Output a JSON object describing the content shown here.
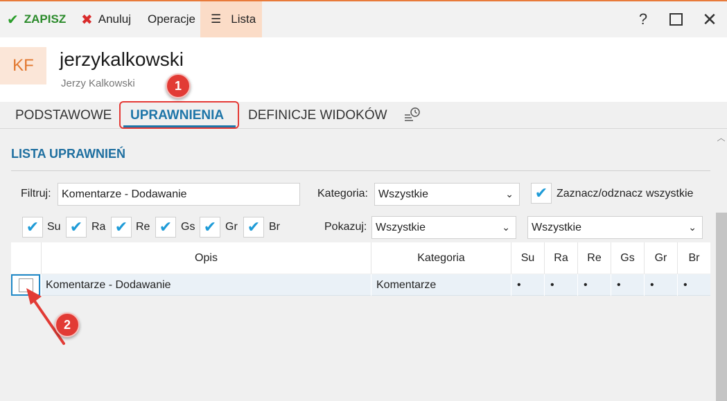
{
  "toolbar": {
    "save_label": "ZAPISZ",
    "cancel_label": "Anuluj",
    "operations_label": "Operacje",
    "list_label": "Lista",
    "help_glyph": "?",
    "accent_color": "#e87a3a"
  },
  "header": {
    "avatar_initials": "KF",
    "login": "jerzykalkowski",
    "full_name": "Jerzy Kalkowski"
  },
  "tabs": [
    {
      "label": "PODSTAWOWE",
      "active": false
    },
    {
      "label": "UPRAWNIENIA",
      "active": true
    },
    {
      "label": "DEFINICJE WIDOKÓW",
      "active": false
    }
  ],
  "section": {
    "title": "LISTA UPRAWNIEŃ"
  },
  "filters": {
    "filter_label": "Filtruj:",
    "filter_value": "Komentarze - Dodawanie",
    "category_label": "Kategoria:",
    "category_value": "Wszystkie",
    "select_all_label": "Zaznacz/odznacz wszystkie",
    "show_label": "Pokazuj:",
    "show_value": "Wszystkie",
    "show_value2": "Wszystkie",
    "checks": [
      "Su",
      "Ra",
      "Re",
      "Gs",
      "Gr",
      "Br"
    ]
  },
  "grid": {
    "columns": [
      "Opis",
      "Kategoria",
      "Su",
      "Ra",
      "Re",
      "Gs",
      "Gr",
      "Br"
    ],
    "rows": [
      {
        "opis": "Komentarze - Dodawanie",
        "kategoria": "Komentarze",
        "su": "•",
        "ra": "•",
        "re": "•",
        "gs": "•",
        "gr": "•",
        "br": "•",
        "checked": false
      }
    ]
  },
  "annotations": {
    "badge1": "1",
    "badge2": "2"
  }
}
